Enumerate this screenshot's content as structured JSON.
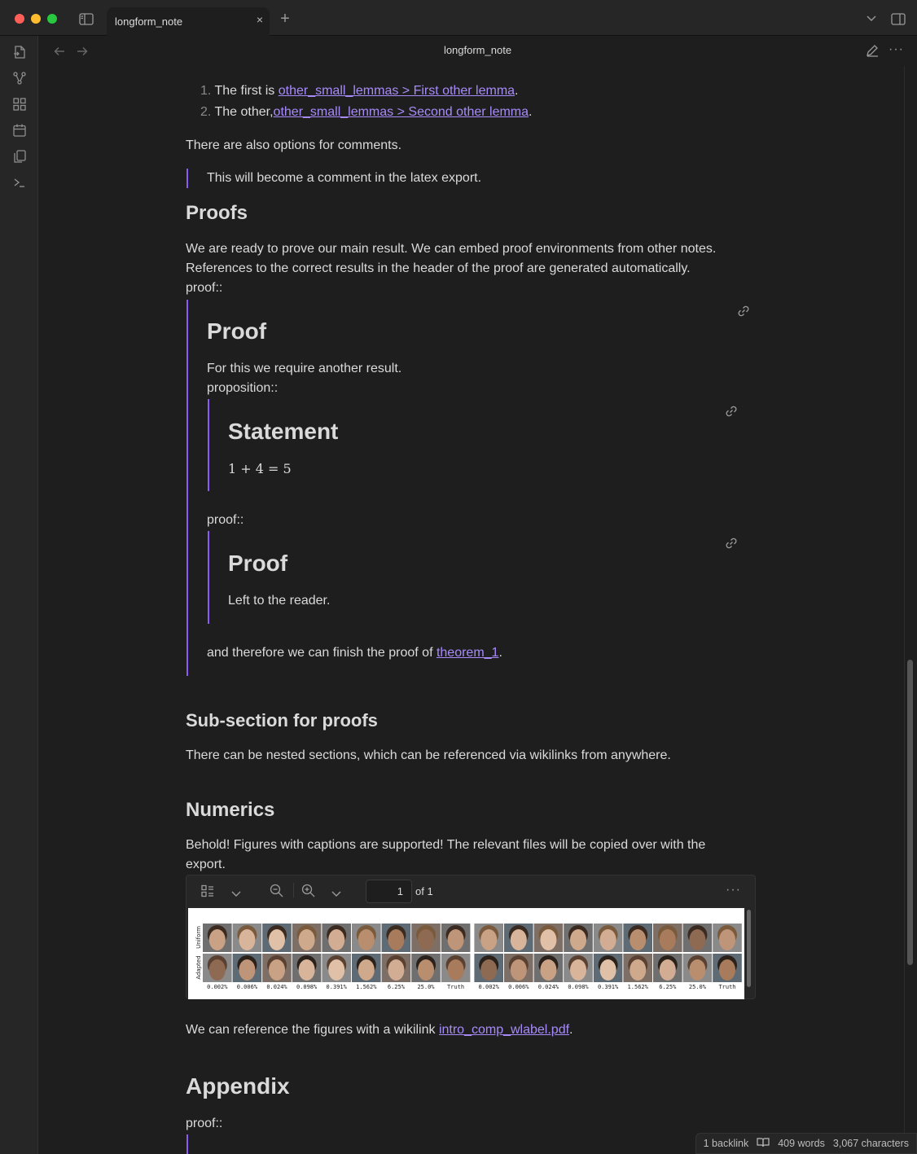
{
  "window": {
    "tab_title": "longform_note",
    "tab_close": "×",
    "new_tab": "+"
  },
  "view": {
    "title": "longform_note"
  },
  "content": {
    "list": [
      {
        "num": "1.",
        "prefix": "The first is ",
        "link": "other_small_lemmas > First other lemma",
        "suffix": "."
      },
      {
        "num": "2.",
        "prefix": "The other,",
        "link": "other_small_lemmas > Second other lemma",
        "suffix": "."
      }
    ],
    "comment_intro": "There are also options for comments.",
    "comment_quote": "This will become a comment in the latex export.",
    "proofs_heading": "Proofs",
    "proofs_para_1": "We are ready to prove our main result. We can embed proof environments from other notes.",
    "proofs_para_2": "References to the correct results in the header of the proof are generated automatically.",
    "proof_marker": "proof::",
    "embed_proof": {
      "heading": "Proof",
      "line1": "For this we require another result.",
      "line2": "proposition::",
      "statement": {
        "heading": "Statement",
        "math": "1 + 4 = 5"
      },
      "proof_marker": "proof::",
      "inner_proof": {
        "heading": "Proof",
        "text": "Left to the reader."
      },
      "finish_prefix": "and therefore we can finish the proof of ",
      "finish_link": "theorem_1",
      "finish_suffix": "."
    },
    "subsection_heading": "Sub-section for proofs",
    "subsection_para": "There can be nested sections, which can be referenced via wikilinks from anywhere.",
    "numerics_heading": "Numerics",
    "numerics_para_1": "Behold! Figures with captions are supported! The relevant files will be copied over with the",
    "numerics_para_2": "export.",
    "pdf": {
      "page_value": "1",
      "page_total": "of 1",
      "row_labels": [
        "Uniform",
        "Adapted"
      ],
      "col_labels": [
        "0.002%",
        "0.006%",
        "0.024%",
        "0.098%",
        "0.391%",
        "1.562%",
        "6.25%",
        "25.0%",
        "Truth",
        "0.002%",
        "0.006%",
        "0.024%",
        "0.098%",
        "0.391%",
        "1.562%",
        "6.25%",
        "25.0%",
        "Truth"
      ]
    },
    "figure_ref_prefix": "We can reference the figures with a wikilink ",
    "figure_ref_link": "intro_comp_wlabel.pdf",
    "figure_ref_suffix": ".",
    "appendix_heading": "Appendix",
    "appendix_marker": "proof::"
  },
  "status": {
    "backlinks": "1 backlink",
    "words": "409 words",
    "characters": "3,067 characters"
  },
  "colors": {
    "accent": "#8a5cf5",
    "link": "#a88bfa",
    "background": "#1e1e1e"
  }
}
